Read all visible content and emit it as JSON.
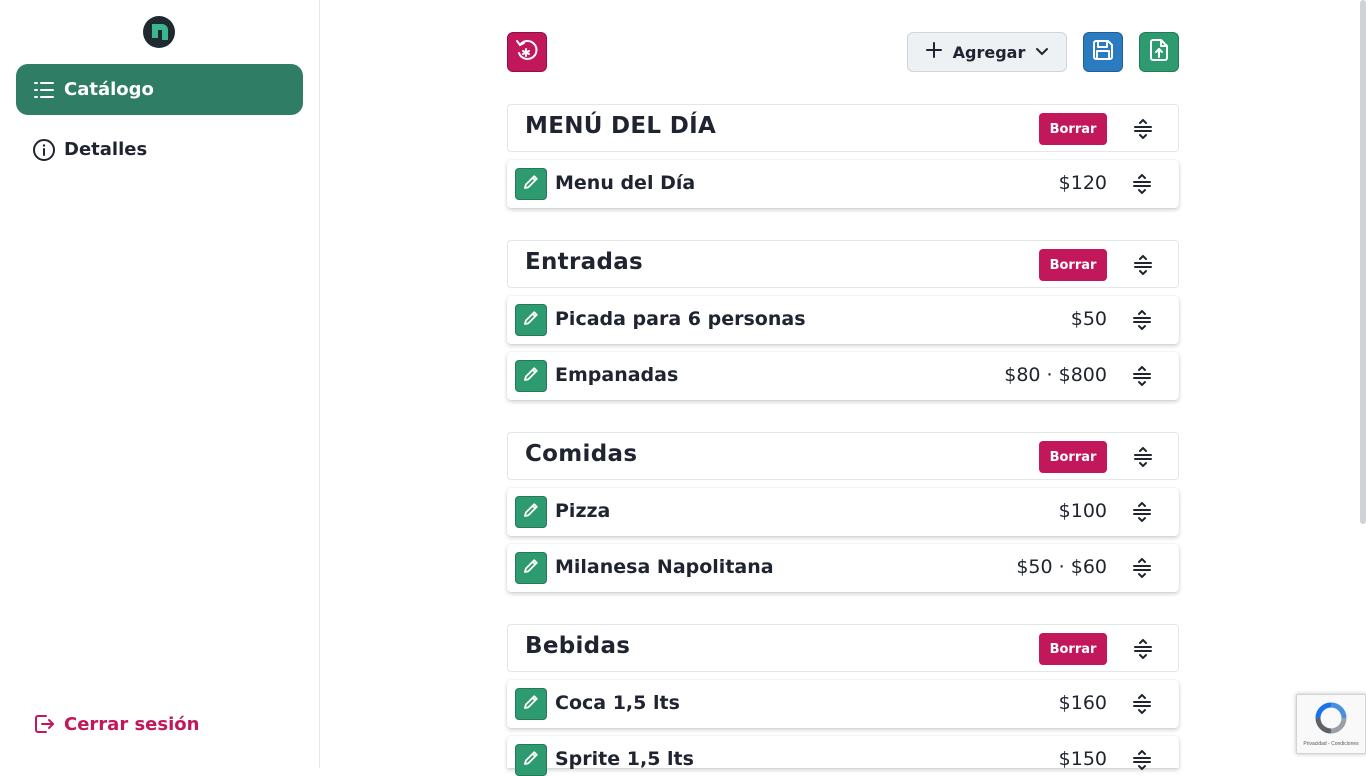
{
  "sidebar": {
    "logo_icon": "app-logo",
    "items": [
      {
        "label": "Catálogo",
        "icon": "list-icon",
        "active": true
      },
      {
        "label": "Detalles",
        "icon": "info-icon",
        "active": false
      }
    ],
    "logout_label": "Cerrar sesión"
  },
  "toolbar": {
    "reset_icon": "reset-icon",
    "add_label": "Agregar",
    "save_icon": "save-icon",
    "export_icon": "export-icon"
  },
  "sections": [
    {
      "title": "MENÚ DEL DÍA",
      "delete_label": "Borrar",
      "items": [
        {
          "name": "Menu del Día",
          "price": "$120"
        }
      ]
    },
    {
      "title": "Entradas",
      "delete_label": "Borrar",
      "items": [
        {
          "name": "Picada para 6 personas",
          "price": "$50"
        },
        {
          "name": "Empanadas",
          "price": "$80 · $800"
        }
      ]
    },
    {
      "title": "Comidas",
      "delete_label": "Borrar",
      "items": [
        {
          "name": "Pizza",
          "price": "$100"
        },
        {
          "name": "Milanesa Napolitana",
          "price": "$50 · $60"
        }
      ]
    },
    {
      "title": "Bebidas",
      "delete_label": "Borrar",
      "items": [
        {
          "name": "Coca 1,5 lts",
          "price": "$160"
        },
        {
          "name": "Sprite 1,5 lts",
          "price": "$150"
        }
      ]
    }
  ],
  "recaptcha": {
    "text": "Privacidad - Condiciones"
  },
  "colors": {
    "primary": "#2e7d64",
    "danger": "#c2185b",
    "save": "#2a7bc0",
    "export": "#2e9a6f"
  }
}
